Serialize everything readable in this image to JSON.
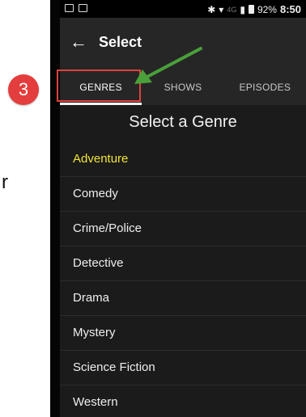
{
  "annotation": {
    "step_number": "3",
    "side_letter": "r"
  },
  "status_bar": {
    "network": "4G",
    "battery": "92%",
    "time": "8:50"
  },
  "app_bar": {
    "title": "Select"
  },
  "tabs": [
    {
      "label": "GENRES",
      "active": true
    },
    {
      "label": "SHOWS",
      "active": false
    },
    {
      "label": "EPISODES",
      "active": false
    }
  ],
  "heading": "Select a Genre",
  "genres": [
    {
      "label": "Adventure",
      "selected": true
    },
    {
      "label": "Comedy"
    },
    {
      "label": "Crime/Police"
    },
    {
      "label": "Detective"
    },
    {
      "label": "Drama"
    },
    {
      "label": "Mystery"
    },
    {
      "label": "Science Fiction"
    },
    {
      "label": "Western"
    }
  ],
  "colors": {
    "selected_genre": "#f0e53a",
    "annotation_red": "#e43d3d",
    "arrow_green": "#4aa03a",
    "background": "#1b1b1b"
  }
}
